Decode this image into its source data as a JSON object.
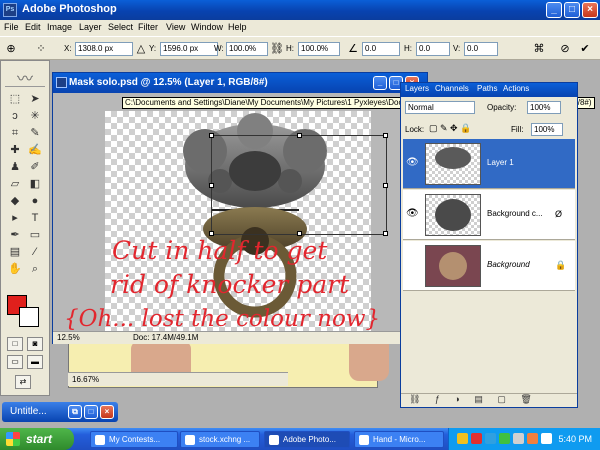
{
  "app": {
    "title": "Adobe Photoshop"
  },
  "menu": [
    "File",
    "Edit",
    "Image",
    "Layer",
    "Select",
    "Filter",
    "View",
    "Window",
    "Help"
  ],
  "options": {
    "x_label": "X:",
    "x_value": "1308.0 px",
    "y_label": "Y:",
    "y_value": "1596.0 px",
    "w_label": "W:",
    "w_value": "100.0%",
    "h_label": "H:",
    "h_value": "100.0%",
    "angle_value": "0.0",
    "hskew_label": "H:",
    "hskew_value": "0.0",
    "vskew_label": "V:",
    "vskew_value": "0.0"
  },
  "document": {
    "title": "Mask solo.psd @ 12.5% (Layer 1, RGB/8#)",
    "path_tooltip": "C:\\Documents and Settings\\Diane\\My Documents\\My Pictures\\1 Pyxleyes\\Door knocker\\Mask solo.psd @ 12.5% (Layer 1, RGB/8#)",
    "zoom": "12.5%",
    "doc_info": "Doc: 17.4M/49.1M"
  },
  "hand_doc": {
    "zoom": "16.67%"
  },
  "annotation": {
    "line1": "Cut in half to get",
    "line2": "rid of knocker part",
    "line3": "{Oh... lost the colour now}"
  },
  "layers_panel": {
    "tabs": [
      "Layers",
      "Channels",
      "Paths",
      "Actions"
    ],
    "blend_mode": "Normal",
    "opacity_label": "Opacity:",
    "opacity_value": "100%",
    "lock_label": "Lock:",
    "fill_label": "Fill:",
    "fill_value": "100%",
    "layers": [
      {
        "name": "Layer 1",
        "active": true,
        "visible": true
      },
      {
        "name": "Background c...",
        "active": false,
        "visible": true
      },
      {
        "name": "Background",
        "active": false,
        "visible": false
      }
    ]
  },
  "minimized_window": {
    "title": "Untitle..."
  },
  "taskbar": {
    "start": "start",
    "tasks": [
      "My Contests...",
      "stock.xchng ...",
      "Adobe Photo...",
      "Hand - Micro..."
    ],
    "clock": "5:40 PM"
  },
  "colors": {
    "foreground": "#e0201c",
    "background": "#ffffff",
    "annotation": "#e2262e"
  }
}
